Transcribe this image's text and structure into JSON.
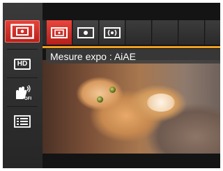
{
  "menu": {
    "active_setting_label": "Mesure expo : AiAE"
  },
  "sidebar": {
    "items": [
      {
        "icon": "metering-icon",
        "active": true
      },
      {
        "icon": "hd-icon",
        "label": "HD",
        "active": false
      },
      {
        "icon": "stabilization-off-icon",
        "active": false
      },
      {
        "icon": "menu-list-icon",
        "active": false
      }
    ]
  },
  "topbar": {
    "options": [
      {
        "icon": "aiae-metering-icon",
        "active": true
      },
      {
        "icon": "spot-metering-icon",
        "active": false
      },
      {
        "icon": "center-weighted-metering-icon",
        "active": false
      }
    ]
  },
  "colors": {
    "accent_red": "#d63129",
    "highlight_orange": "#f0a020",
    "panel_dark": "#2b2b2b"
  }
}
